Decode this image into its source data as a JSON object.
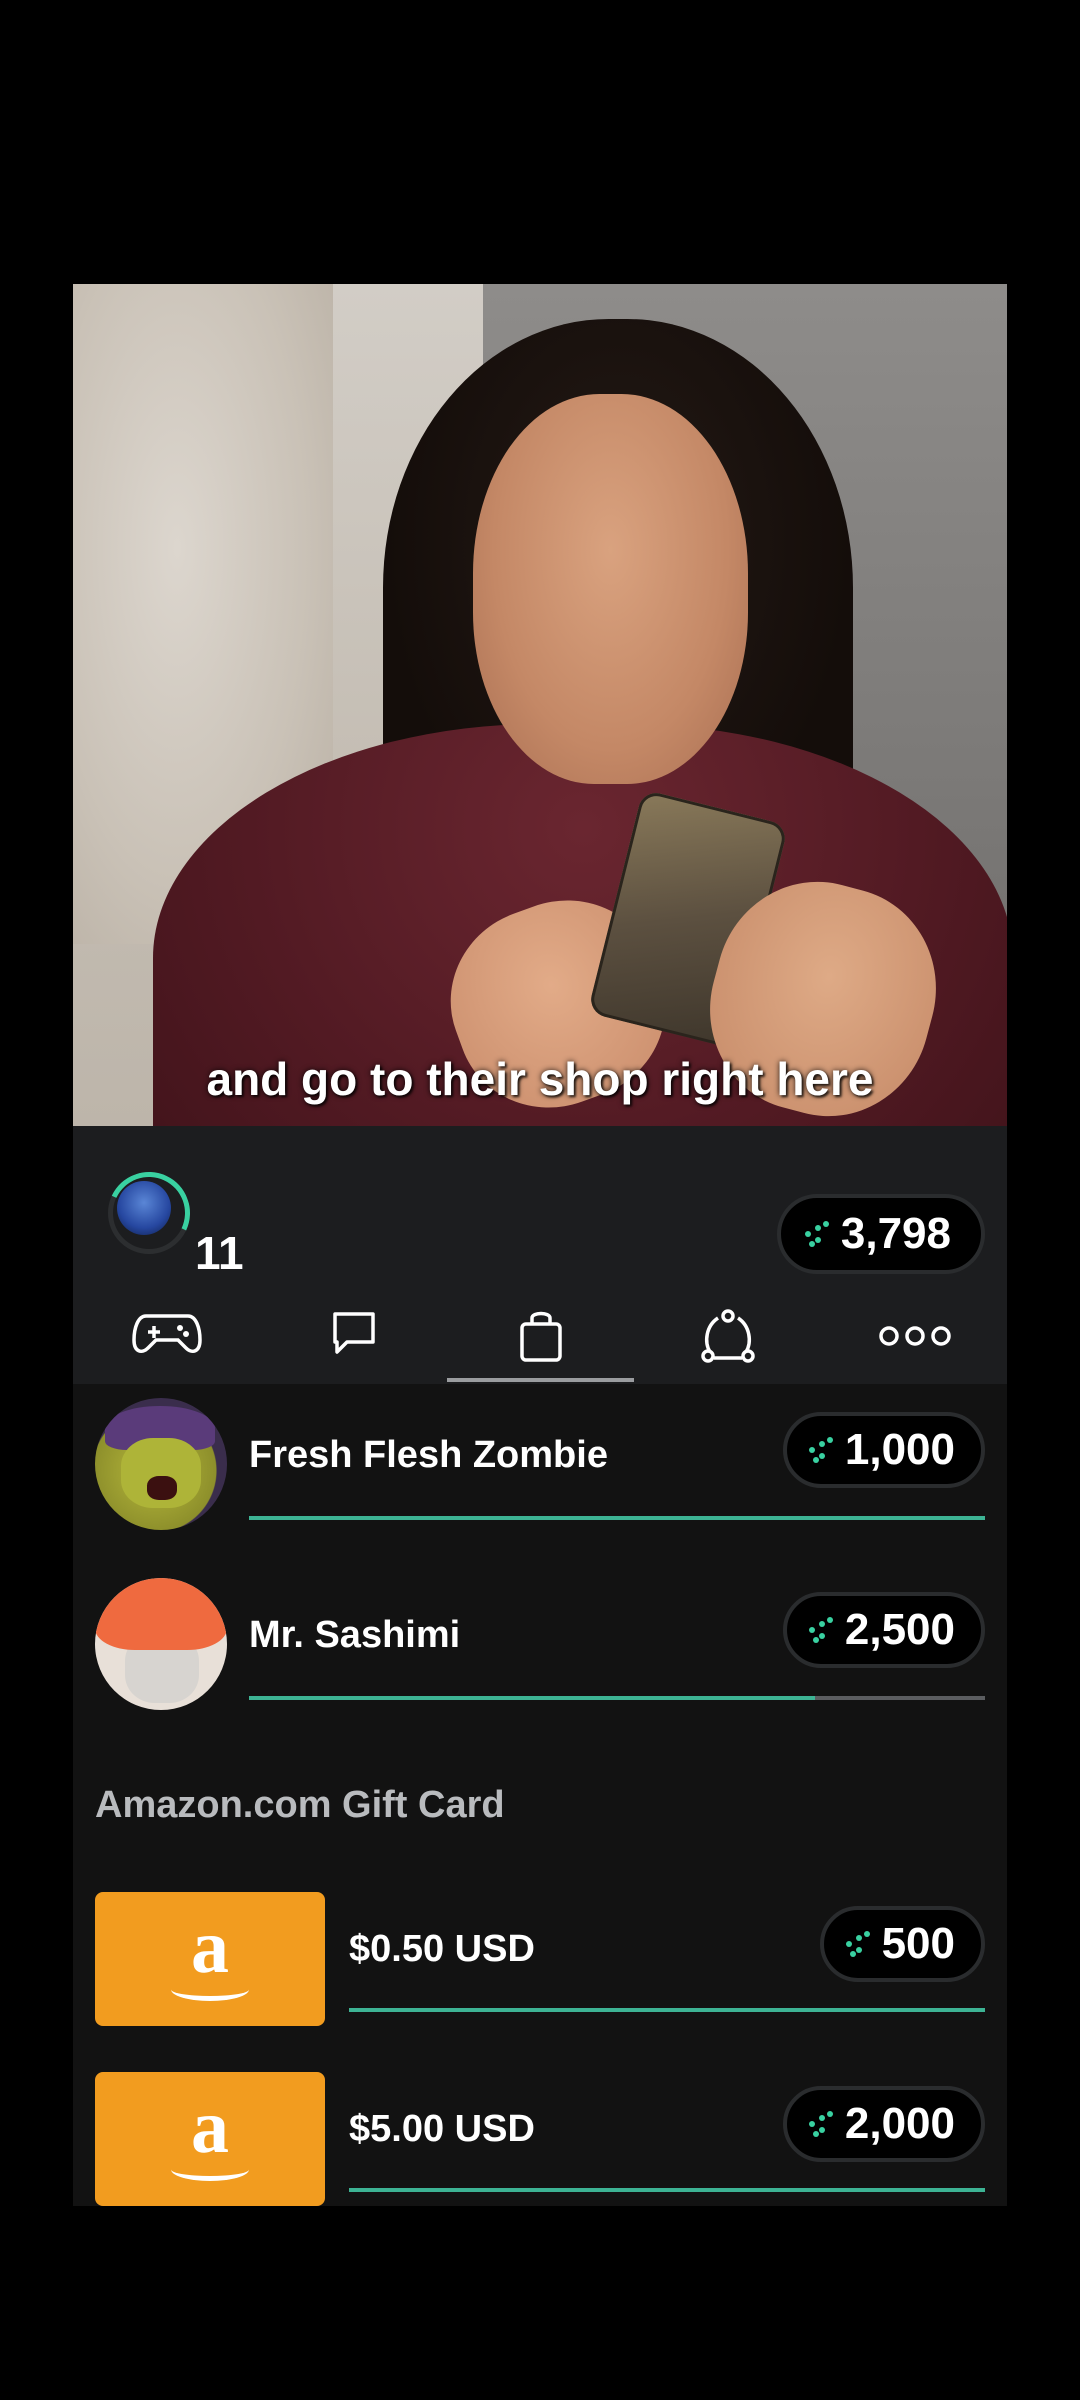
{
  "video": {
    "caption": "and go to their shop right here"
  },
  "header": {
    "level": "11",
    "balance": "3,798"
  },
  "tabs": [
    {
      "name": "games",
      "icon": "gamepad-icon"
    },
    {
      "name": "chat",
      "icon": "chat-bubble-icon"
    },
    {
      "name": "shop",
      "icon": "shopping-bag-icon",
      "active": true
    },
    {
      "name": "social",
      "icon": "share-nodes-icon"
    },
    {
      "name": "more",
      "icon": "more-dots-icon"
    }
  ],
  "items": [
    {
      "name": "Fresh Flesh Zombie",
      "price": "1,000"
    },
    {
      "name": "Mr. Sashimi",
      "price": "2,500"
    }
  ],
  "gift_section": {
    "title": "Amazon.com Gift Card",
    "cards": [
      {
        "label": "$0.50 USD",
        "price": "500",
        "logo_letter": "a"
      },
      {
        "label": "$5.00 USD",
        "price": "2,000",
        "logo_letter": "a"
      }
    ]
  },
  "colors": {
    "accent": "#39d1a1",
    "amazon_orange": "#f29c1f",
    "panel": "#1c1d1f"
  }
}
